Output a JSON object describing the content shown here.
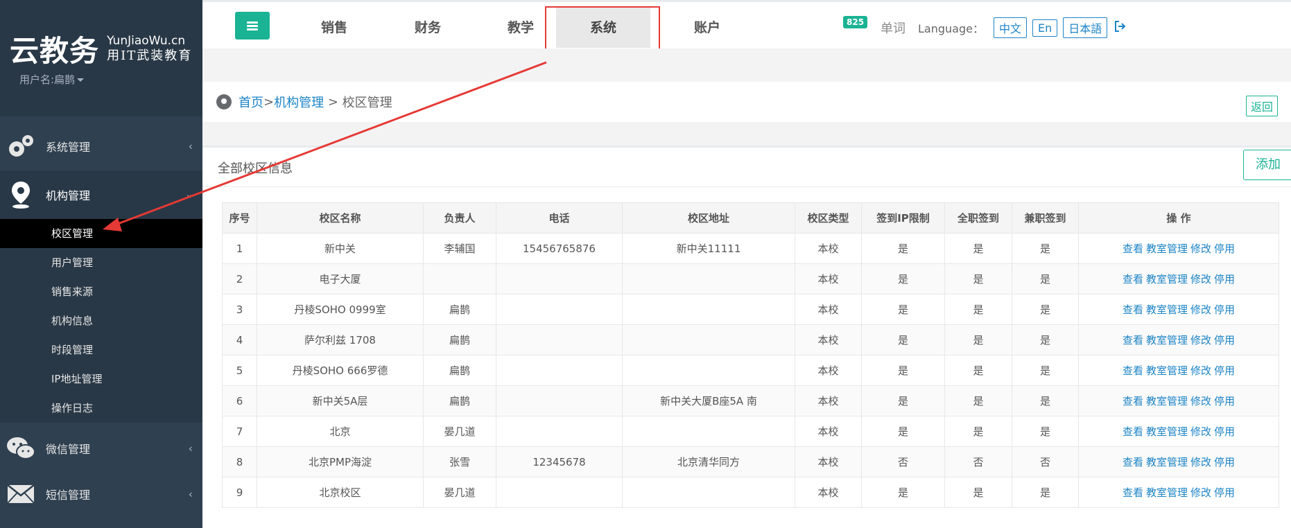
{
  "sidebar": {
    "brand_main": "云教务",
    "brand_en": "YunJiaoWu.cn",
    "brand_slogan": "用IT武装教育",
    "user": "用户名:扁鹊",
    "groups": {
      "system": {
        "label": "系统管理",
        "icon": "gears-icon"
      },
      "org": {
        "label": "机构管理",
        "icon": "location-pin-icon"
      },
      "wechat": {
        "label": "微信管理",
        "icon": "wechat-icon"
      },
      "sms": {
        "label": "短信管理",
        "icon": "envelope-icon"
      }
    },
    "org_items": [
      "校区管理",
      "用户管理",
      "销售来源",
      "机构信息",
      "时段管理",
      "IP地址管理",
      "操作日志"
    ]
  },
  "topbar": {
    "tabs": [
      "销售",
      "财务",
      "教学",
      "系统",
      "账户"
    ],
    "active_tab": "系统",
    "badge": "825",
    "word": "单词",
    "language_label": "Language：",
    "languages": [
      "中文",
      "En",
      "日本語"
    ]
  },
  "breadcrumb": {
    "home": "首页",
    "sep1": " >",
    "org": "机构管理",
    "sep2": " > ",
    "current": "校区管理",
    "return": "返回"
  },
  "panel": {
    "title": "全部校区信息",
    "add": "添加"
  },
  "table": {
    "headers": [
      "序号",
      "校区名称",
      "负责人",
      "电话",
      "校区地址",
      "校区类型",
      "签到IP限制",
      "全职签到",
      "兼职签到",
      "操 作"
    ],
    "actions": [
      "查看",
      "教室管理",
      "修改",
      "停用"
    ],
    "rows": [
      [
        "1",
        "新中关",
        "李辅国",
        "15456765876",
        "新中关11111",
        "本校",
        "是",
        "是",
        "是"
      ],
      [
        "2",
        "电子大厦",
        "",
        "",
        "",
        "本校",
        "是",
        "是",
        "是"
      ],
      [
        "3",
        "丹棱SOHO 0999室",
        "扁鹊",
        "",
        "",
        "本校",
        "是",
        "是",
        "是"
      ],
      [
        "4",
        "萨尔利兹 1708",
        "扁鹊",
        "",
        "",
        "本校",
        "是",
        "是",
        "是"
      ],
      [
        "5",
        "丹棱SOHO 666罗德",
        "扁鹊",
        "",
        "",
        "本校",
        "是",
        "是",
        "是"
      ],
      [
        "6",
        "新中关5A层",
        "扁鹊",
        "",
        "新中关大厦B座5A 南",
        "本校",
        "是",
        "是",
        "是"
      ],
      [
        "7",
        "北京",
        "晏几道",
        "",
        "",
        "本校",
        "是",
        "是",
        "是"
      ],
      [
        "8",
        "北京PMP海淀",
        "张雪",
        "12345678",
        "北京清华同方",
        "本校",
        "否",
        "否",
        "否"
      ],
      [
        "9",
        "北京校区",
        "晏几道",
        "",
        "",
        "本校",
        "是",
        "是",
        "是"
      ]
    ]
  },
  "colors": {
    "accent": "#1ab394",
    "link": "#1c84c6",
    "sidebar": "#2f4050",
    "annotation": "#e53935"
  }
}
